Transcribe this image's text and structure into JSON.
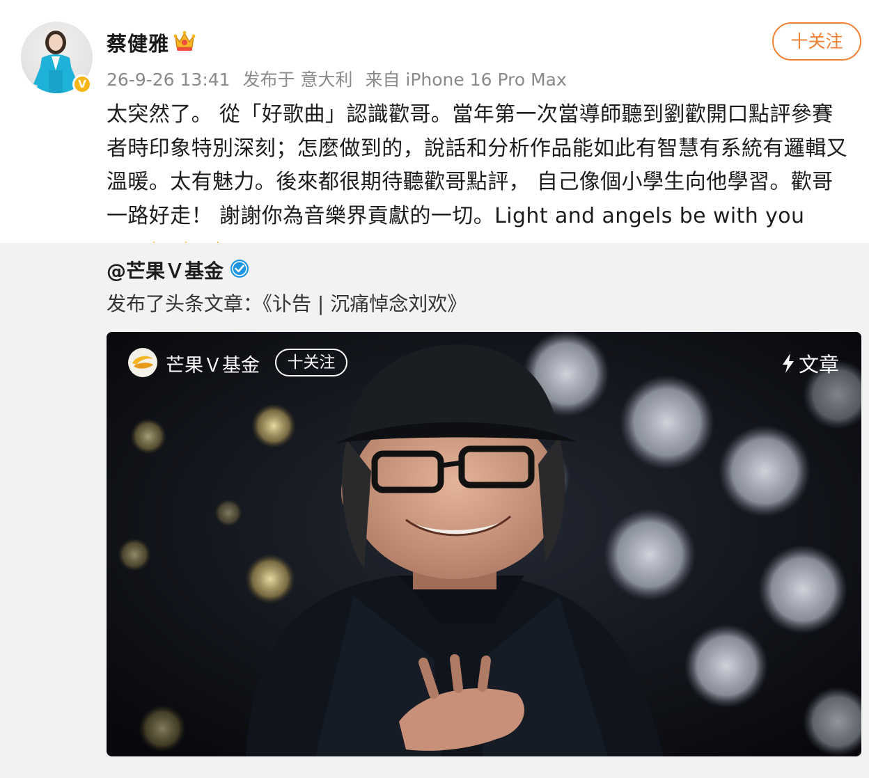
{
  "post": {
    "author": "蔡健雅",
    "date": "26-9-26 13:41",
    "location": "发布于 意大利",
    "device": "来自 iPhone 16 Pro Max",
    "follow_label": "十关注",
    "text": "太突然了。 從「好歌曲」認識歡哥。當年第一次當導師聽到劉歡開口點評參賽者時印象特別深刻；怎麼做到的，說話和分析作品能如此有智慧有系統有邏輯又溫暖。太有魅力。後來都很期待聽歡哥點評， 自己像個小學生向他學習。歡哥一路好走！ 謝謝你為音樂界貢獻的一切。Light and angels be with you"
  },
  "repost": {
    "author": "@芒果Ｖ基金",
    "text": "发布了头条文章：《讣告 | 沉痛悼念刘欢》"
  },
  "article_card": {
    "account": "芒果Ｖ基金",
    "follow_label": "十关注",
    "tag": "文章"
  },
  "colors": {
    "accent": "#f08036",
    "verified_gold": "#f6b618",
    "verified_blue": "#1d95e0",
    "repost_bg": "#f2f2f2"
  },
  "icons": {
    "verified": "verified-badge-icon",
    "crown": "crown-icon",
    "heart": "red-heart-emoji",
    "candle": "candle-emoji",
    "bolt": "lightning-icon"
  }
}
